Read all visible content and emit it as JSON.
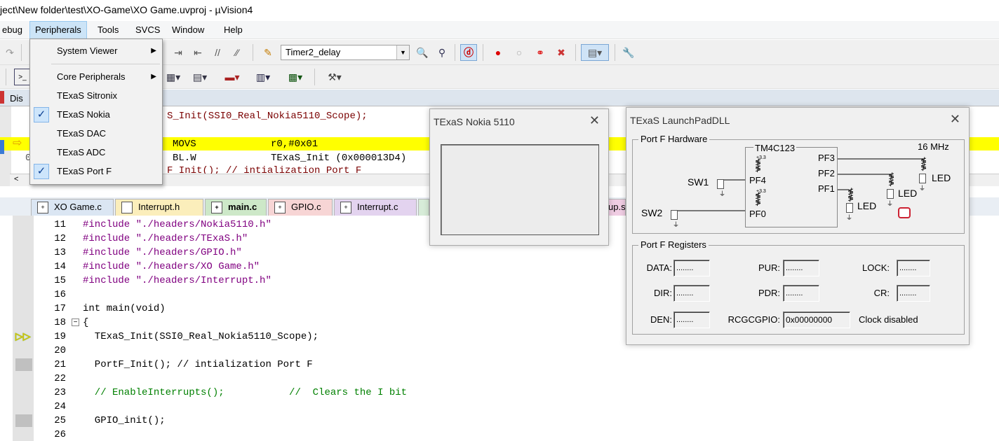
{
  "title": "ject\\New folder\\test\\XO-Game\\XO Game.uvproj - µVision4",
  "menu": {
    "debug": "ebug",
    "peripherals": "Peripherals",
    "tools": "Tools",
    "svcs": "SVCS",
    "window": "Window",
    "help": "Help"
  },
  "peripherals_menu": {
    "system_viewer": "System Viewer",
    "core_peripherals": "Core Peripherals",
    "sitronix": "TExaS Sitronix",
    "nokia": "TExaS Nokia",
    "dac": "TExaS DAC",
    "adc": "TExaS ADC",
    "portf": "TExaS Port F"
  },
  "toolbar": {
    "target_combo": "Timer2_delay"
  },
  "disasm": {
    "tab_label": "Dis",
    "line1": "S_Init(SSI0_Real_Nokia5110_Scope);",
    "line2_op": "MOVS",
    "line2_args": "r0,#0x01",
    "line3_op": "BL.W",
    "line3_args": "TExaS_Init (0x000013D4)",
    "line4": "F_Init(); // intialization Port F",
    "row_marker": "0"
  },
  "tabs": [
    "XO Game.c",
    "Interrupt.h",
    "main.c",
    "GPIO.c",
    "Interrupt.c",
    "up.s"
  ],
  "code_lines": [
    {
      "n": "11",
      "t": "#include \"./headers/Nokia5110.h\""
    },
    {
      "n": "12",
      "t": "#include \"./headers/TExaS.h\""
    },
    {
      "n": "13",
      "t": "#include \"./headers/GPIO.h\""
    },
    {
      "n": "14",
      "t": "#include \"./headers/XO Game.h\""
    },
    {
      "n": "15",
      "t": "#include \"./headers/Interrupt.h\""
    },
    {
      "n": "16",
      "t": ""
    },
    {
      "n": "17",
      "t": "int main(void)"
    },
    {
      "n": "18",
      "t": "{"
    },
    {
      "n": "19",
      "t": "  TExaS_Init(SSI0_Real_Nokia5110_Scope);"
    },
    {
      "n": "20",
      "t": ""
    },
    {
      "n": "21",
      "t": "  PortF_Init(); // intialization Port F"
    },
    {
      "n": "22",
      "t": ""
    },
    {
      "n": "23",
      "t": "  // EnableInterrupts();           //  Clears the I bit"
    },
    {
      "n": "24",
      "t": ""
    },
    {
      "n": "25",
      "t": "  GPIO_init();"
    },
    {
      "n": "26",
      "t": ""
    }
  ],
  "nokia_window": {
    "title": "TExaS Nokia 5110"
  },
  "launchpad": {
    "title": "TExaS LaunchPadDLL",
    "hw_group": "Port F Hardware",
    "chip": "TM4C123",
    "freq": "16 MHz",
    "sw1": "SW1",
    "sw2": "SW2",
    "pf4": "PF4",
    "pf0": "PF0",
    "pf3": "PF3",
    "pf2": "PF2",
    "pf1": "PF1",
    "led": "LED",
    "v33": "+3.3",
    "reg_group": "Port F Registers",
    "data_lbl": "DATA:",
    "data_val": "........",
    "dir_lbl": "DIR:",
    "dir_val": "........",
    "den_lbl": "DEN:",
    "den_val": "........",
    "pur_lbl": "PUR:",
    "pur_val": "........",
    "pdr_lbl": "PDR:",
    "pdr_val": "........",
    "lock_lbl": "LOCK:",
    "lock_val": "........",
    "cr_lbl": "CR:",
    "cr_val": "........",
    "rcgc_lbl": "RCGCGPIO:",
    "rcgc_val": "0x00000000",
    "clock_status": "Clock disabled"
  }
}
